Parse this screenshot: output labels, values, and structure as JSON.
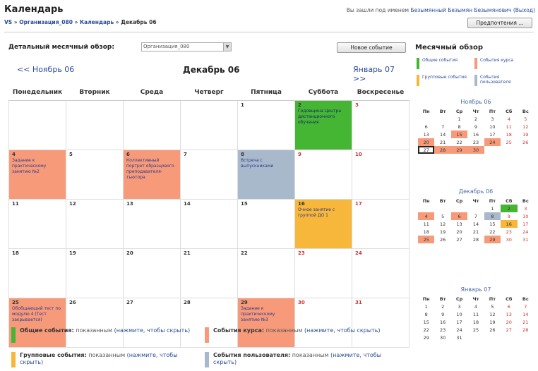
{
  "header": {
    "title": "Календарь",
    "login_prefix": "Вы зашли под именем",
    "login_user": "Безымянный Безымян Безымянович",
    "logout": "(Выход)",
    "preferences_label": "Предпочтения ..."
  },
  "breadcrumb": {
    "items": [
      "VS",
      "Организация_080",
      "Календарь"
    ],
    "current": "Декабрь 06"
  },
  "toolbar": {
    "detail_label": "Детальный месячный обзор:",
    "course_select": "Организация_080",
    "new_event_label": "Новое событие"
  },
  "nav": {
    "prev": "<< Ноябрь 06",
    "current": "Декабрь 06",
    "next": "Январь 07 >>"
  },
  "weekdays": [
    "Понедельник",
    "Вторник",
    "Среда",
    "Четверг",
    "Пятница",
    "Суббота",
    "Воскресенье"
  ],
  "weeks": [
    [
      {
        "d": ""
      },
      {
        "d": ""
      },
      {
        "d": ""
      },
      {
        "d": ""
      },
      {
        "d": "1"
      },
      {
        "d": "2",
        "type": "global",
        "event": "Годовщина Центра дистанционного обучения"
      },
      {
        "d": "3",
        "wk": true
      }
    ],
    [
      {
        "d": "4",
        "type": "course",
        "event": "Задание к практическому занятию №2"
      },
      {
        "d": "5"
      },
      {
        "d": "6",
        "type": "course",
        "event": "Коллективный портрет образцового преподавателя-тьютора"
      },
      {
        "d": "7"
      },
      {
        "d": "8",
        "type": "user",
        "event": "Встреча с выпускниками"
      },
      {
        "d": "9",
        "wk": true
      },
      {
        "d": "10",
        "wk": true
      }
    ],
    [
      {
        "d": "11"
      },
      {
        "d": "12"
      },
      {
        "d": "13"
      },
      {
        "d": "14"
      },
      {
        "d": "15"
      },
      {
        "d": "16",
        "type": "group",
        "event": "Очное занятие с группой ДО 1"
      },
      {
        "d": "17",
        "wk": true
      }
    ],
    [
      {
        "d": "18"
      },
      {
        "d": "19"
      },
      {
        "d": "20"
      },
      {
        "d": "21"
      },
      {
        "d": "22"
      },
      {
        "d": "23",
        "wk": true
      },
      {
        "d": "24",
        "wk": true
      }
    ],
    [
      {
        "d": "25",
        "type": "course",
        "event": "Обобщающий тест по модулю 4 (Тест закрывается)"
      },
      {
        "d": "26"
      },
      {
        "d": "27"
      },
      {
        "d": "28"
      },
      {
        "d": "29",
        "type": "course",
        "event": "Задание к практическому занятию №3"
      },
      {
        "d": "30",
        "wk": true
      },
      {
        "d": "31",
        "wk": true
      }
    ]
  ],
  "legend": {
    "global": {
      "label": "Общие события:",
      "status": "показанным",
      "link": "(нажмите, чтобы скрыть)",
      "color": "#45b534"
    },
    "course": {
      "label": "События курса:",
      "status": "показанным",
      "link": "(нажмите, чтобы скрыть)",
      "color": "#f79a7a"
    },
    "group": {
      "label": "Групповые события:",
      "status": "показанным",
      "link": "(нажмите, чтобы скрыть)",
      "color": "#f7b73a"
    },
    "user": {
      "label": "События пользователя:",
      "status": "показанным",
      "link": "(нажмите, чтобы скрыть)",
      "color": "#a9b9cc"
    }
  },
  "side": {
    "title": "Месячный обзор",
    "legend": [
      {
        "label": "Общие события",
        "color": "#45b534"
      },
      {
        "label": "События курса",
        "color": "#f79a7a"
      },
      {
        "label": "Групповые события",
        "color": "#f7b73a"
      },
      {
        "label": "События пользователя",
        "color": "#a9b9cc"
      }
    ],
    "mini_weekdays": [
      "Пн",
      "Вт",
      "Ср",
      "Чт",
      "Пт",
      "Сб",
      "Вс"
    ],
    "months": [
      {
        "title": "Ноябрь 06",
        "weeks": [
          [
            {
              "d": ""
            },
            {
              "d": ""
            },
            {
              "d": "1"
            },
            {
              "d": "2"
            },
            {
              "d": "3"
            },
            {
              "d": "4",
              "c": "wk"
            },
            {
              "d": "5",
              "c": "wk"
            }
          ],
          [
            {
              "d": "6"
            },
            {
              "d": "7"
            },
            {
              "d": "8"
            },
            {
              "d": "9"
            },
            {
              "d": "10"
            },
            {
              "d": "11",
              "c": "wk"
            },
            {
              "d": "12",
              "c": "wk"
            }
          ],
          [
            {
              "d": "13"
            },
            {
              "d": "14"
            },
            {
              "d": "15",
              "c": "course"
            },
            {
              "d": "16"
            },
            {
              "d": "17"
            },
            {
              "d": "18",
              "c": "wk"
            },
            {
              "d": "19",
              "c": "wk"
            }
          ],
          [
            {
              "d": "20",
              "c": "course"
            },
            {
              "d": "21"
            },
            {
              "d": "22"
            },
            {
              "d": "23"
            },
            {
              "d": "24",
              "c": "course"
            },
            {
              "d": "25",
              "c": "wk"
            },
            {
              "d": "26",
              "c": "wk"
            }
          ],
          [
            {
              "d": "27",
              "c": "today"
            },
            {
              "d": "28",
              "c": "course"
            },
            {
              "d": "29",
              "c": "course"
            },
            {
              "d": "30",
              "c": "course"
            },
            {
              "d": ""
            },
            {
              "d": ""
            },
            {
              "d": ""
            }
          ]
        ]
      },
      {
        "title": "Декабрь 06",
        "weeks": [
          [
            {
              "d": ""
            },
            {
              "d": ""
            },
            {
              "d": ""
            },
            {
              "d": ""
            },
            {
              "d": "1"
            },
            {
              "d": "2",
              "c": "global"
            },
            {
              "d": "3",
              "c": "wk"
            }
          ],
          [
            {
              "d": "4",
              "c": "course"
            },
            {
              "d": "5"
            },
            {
              "d": "6",
              "c": "course"
            },
            {
              "d": "7"
            },
            {
              "d": "8",
              "c": "user"
            },
            {
              "d": "9",
              "c": "wk"
            },
            {
              "d": "10",
              "c": "wk"
            }
          ],
          [
            {
              "d": "11"
            },
            {
              "d": "12"
            },
            {
              "d": "13"
            },
            {
              "d": "14"
            },
            {
              "d": "15"
            },
            {
              "d": "16",
              "c": "group"
            },
            {
              "d": "17",
              "c": "wk"
            }
          ],
          [
            {
              "d": "18"
            },
            {
              "d": "19"
            },
            {
              "d": "20"
            },
            {
              "d": "21"
            },
            {
              "d": "22"
            },
            {
              "d": "23",
              "c": "wk"
            },
            {
              "d": "24",
              "c": "wk"
            }
          ],
          [
            {
              "d": "25",
              "c": "course"
            },
            {
              "d": "26"
            },
            {
              "d": "27"
            },
            {
              "d": "28"
            },
            {
              "d": "29",
              "c": "course"
            },
            {
              "d": "30",
              "c": "wk"
            },
            {
              "d": "31",
              "c": "wk"
            }
          ]
        ]
      },
      {
        "title": "Январь 07",
        "weeks": [
          [
            {
              "d": "1"
            },
            {
              "d": "2"
            },
            {
              "d": "3"
            },
            {
              "d": "4"
            },
            {
              "d": "5"
            },
            {
              "d": "6",
              "c": "wk"
            },
            {
              "d": "7",
              "c": "wk"
            }
          ],
          [
            {
              "d": "8"
            },
            {
              "d": "9"
            },
            {
              "d": "10"
            },
            {
              "d": "11"
            },
            {
              "d": "12"
            },
            {
              "d": "13",
              "c": "wk"
            },
            {
              "d": "14",
              "c": "wk"
            }
          ],
          [
            {
              "d": "15"
            },
            {
              "d": "16"
            },
            {
              "d": "17"
            },
            {
              "d": "18"
            },
            {
              "d": "19"
            },
            {
              "d": "20",
              "c": "wk"
            },
            {
              "d": "21",
              "c": "wk"
            }
          ],
          [
            {
              "d": "22"
            },
            {
              "d": "23"
            },
            {
              "d": "24"
            },
            {
              "d": "25"
            },
            {
              "d": "26"
            },
            {
              "d": "27",
              "c": "wk"
            },
            {
              "d": "28",
              "c": "wk"
            }
          ],
          [
            {
              "d": "29"
            },
            {
              "d": "30"
            },
            {
              "d": "31"
            },
            {
              "d": ""
            },
            {
              "d": ""
            },
            {
              "d": ""
            },
            {
              "d": ""
            }
          ]
        ]
      }
    ]
  }
}
